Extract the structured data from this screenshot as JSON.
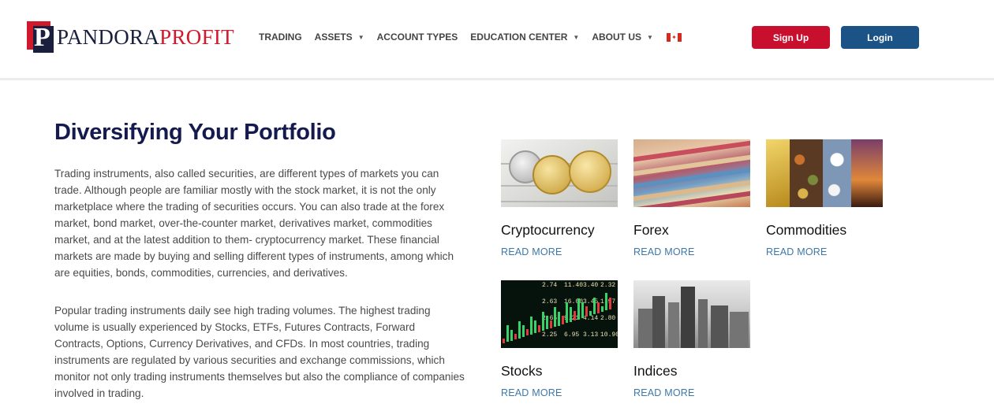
{
  "brand": {
    "name_part1": "PANDORA",
    "name_part2": "PROFIT",
    "logo_letter": "P"
  },
  "nav": {
    "items": [
      {
        "label": "TRADING",
        "dropdown": false
      },
      {
        "label": "ASSETS",
        "dropdown": true
      },
      {
        "label": "ACCOUNT TYPES",
        "dropdown": false
      },
      {
        "label": "EDUCATION CENTER",
        "dropdown": true
      },
      {
        "label": "ABOUT US",
        "dropdown": true
      }
    ],
    "flag_icon": "canada-flag-icon"
  },
  "header_buttons": {
    "signup": "Sign Up",
    "login": "Login"
  },
  "main": {
    "title": "Diversifying Your Portfolio",
    "paragraphs": [
      "Trading instruments, also called securities, are different types of markets you can trade. Although people are familiar mostly with the stock market, it is not the only marketplace where the trading of securities occurs. You can also trade at the forex market, bond market, over-the-counter market, derivatives market, commodities market, and at the latest addition to them- cryptocurrency market. These financial markets are made by buying and selling different types of instruments, among which are equities, bonds, commodities, currencies, and derivatives.",
      "Popular trading instruments daily see high trading volumes. The highest trading volume is usually experienced by Stocks, ETFs, Futures Contracts, Forward Contracts, Options, Currency Derivatives, and CFDs. In most countries, trading instruments are regulated by various securities and exchange commissions, which monitor not only trading instruments themselves but also the compliance of companies involved in trading."
    ]
  },
  "cards": [
    {
      "name": "Cryptocurrency",
      "link": "READ MORE"
    },
    {
      "name": "Forex",
      "link": "READ MORE"
    },
    {
      "name": "Commodities",
      "link": "READ MORE"
    },
    {
      "name": "Stocks",
      "link": "READ MORE"
    },
    {
      "name": "Indices",
      "link": "READ MORE"
    }
  ],
  "stocks_thumb_numbers": [
    "2.74",
    "11.40",
    "3.40",
    "2.32",
    "2.63",
    "16.00",
    "3.45",
    "1.97",
    "2.65",
    "9.21",
    "4.14",
    "2.80",
    "2.25",
    "6.95",
    "3.13",
    "10.90"
  ],
  "colors": {
    "brand_navy": "#1a1f3d",
    "brand_red": "#d0192b",
    "signup": "#c8102e",
    "login": "#1b5386",
    "title": "#141a4d",
    "read_more": "#3d78a8"
  }
}
